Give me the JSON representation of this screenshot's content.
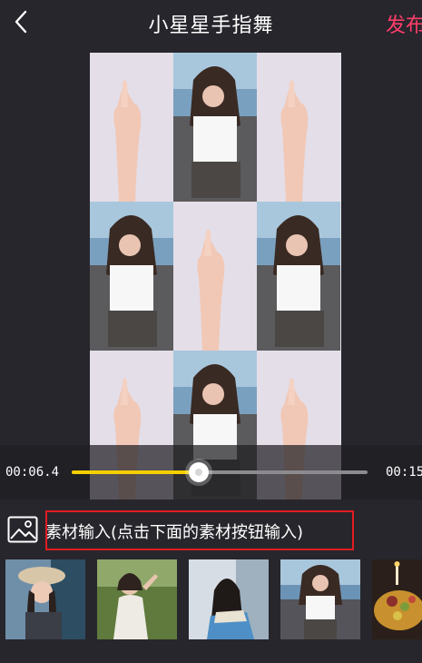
{
  "header": {
    "title": "小星星手指舞",
    "publish_label": "发布"
  },
  "player": {
    "current_time": "00:06.4",
    "total_time": "00:15",
    "progress": 0.43
  },
  "assets": {
    "label": "素材输入(点击下面的素材按钮输入)"
  },
  "thumbnails": [
    {
      "id": "thumb-1"
    },
    {
      "id": "thumb-2"
    },
    {
      "id": "thumb-3"
    },
    {
      "id": "thumb-4"
    },
    {
      "id": "thumb-5"
    }
  ],
  "colors": {
    "background": "#27262c",
    "accent": "#ff3d6b",
    "progress": "#f5cf00",
    "highlight_box": "#e21b23"
  }
}
